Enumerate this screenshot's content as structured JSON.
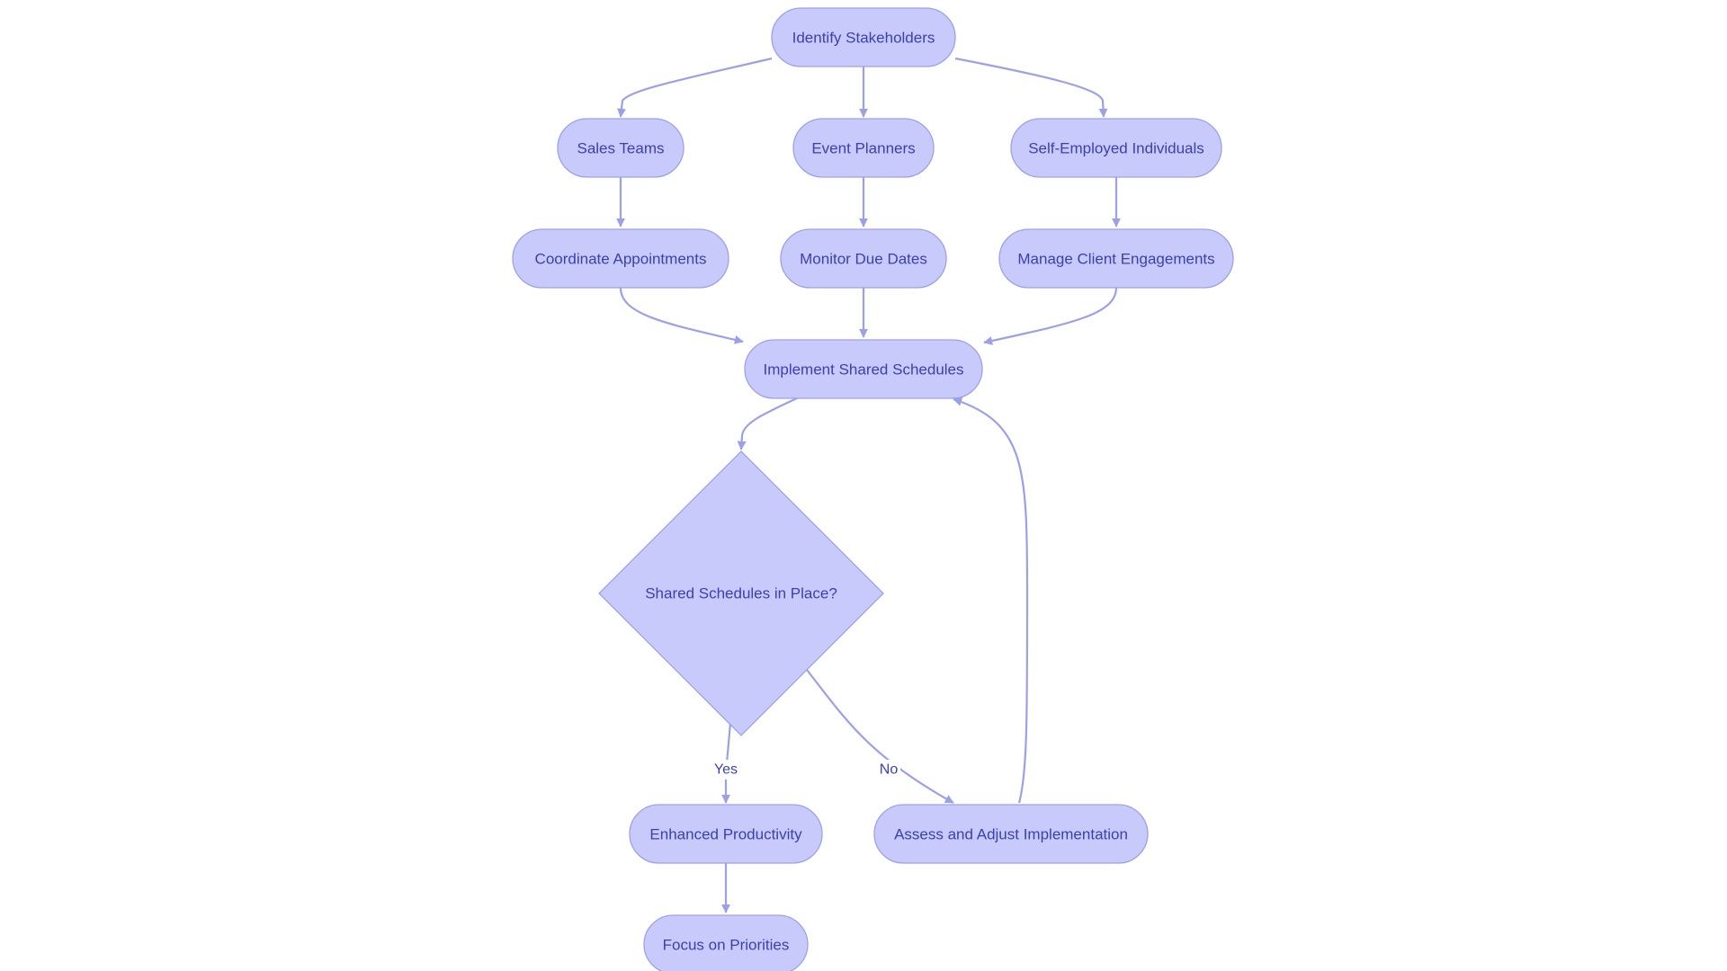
{
  "diagram": {
    "type": "flowchart",
    "colors": {
      "node_fill": "#c8cafc",
      "node_stroke": "#9da2e6",
      "edge": "#9ba0e8",
      "text": "#3b3fb0",
      "background": "#ffffff"
    },
    "nodes": {
      "identify": {
        "label": "Identify Stakeholders",
        "shape": "stadium"
      },
      "sales": {
        "label": "Sales Teams",
        "shape": "stadium"
      },
      "events": {
        "label": "Event Planners",
        "shape": "stadium"
      },
      "self": {
        "label": "Self-Employed Individuals",
        "shape": "stadium"
      },
      "coordinate": {
        "label": "Coordinate Appointments",
        "shape": "stadium"
      },
      "monitor": {
        "label": "Monitor Due Dates",
        "shape": "stadium"
      },
      "manage": {
        "label": "Manage Client Engagements",
        "shape": "stadium"
      },
      "implement": {
        "label": "Implement Shared Schedules",
        "shape": "stadium"
      },
      "decision": {
        "label": "Shared Schedules in Place?",
        "shape": "diamond"
      },
      "enhanced": {
        "label": "Enhanced Productivity",
        "shape": "stadium"
      },
      "assess": {
        "label": "Assess and Adjust Implementation",
        "shape": "stadium"
      },
      "focus": {
        "label": "Focus on Priorities",
        "shape": "stadium"
      }
    },
    "edges": [
      {
        "from": "identify",
        "to": "sales",
        "label": ""
      },
      {
        "from": "identify",
        "to": "events",
        "label": ""
      },
      {
        "from": "identify",
        "to": "self",
        "label": ""
      },
      {
        "from": "sales",
        "to": "coordinate",
        "label": ""
      },
      {
        "from": "events",
        "to": "monitor",
        "label": ""
      },
      {
        "from": "self",
        "to": "manage",
        "label": ""
      },
      {
        "from": "coordinate",
        "to": "implement",
        "label": ""
      },
      {
        "from": "monitor",
        "to": "implement",
        "label": ""
      },
      {
        "from": "manage",
        "to": "implement",
        "label": ""
      },
      {
        "from": "implement",
        "to": "decision",
        "label": ""
      },
      {
        "from": "decision",
        "to": "enhanced",
        "label": "Yes"
      },
      {
        "from": "decision",
        "to": "assess",
        "label": "No"
      },
      {
        "from": "assess",
        "to": "implement",
        "label": ""
      },
      {
        "from": "enhanced",
        "to": "focus",
        "label": ""
      }
    ],
    "edge_labels": {
      "yes": "Yes",
      "no": "No"
    }
  }
}
